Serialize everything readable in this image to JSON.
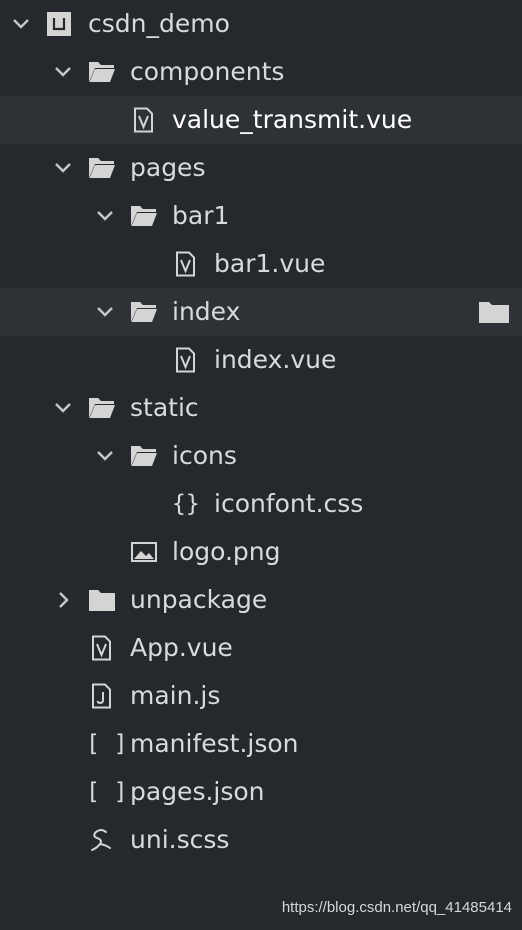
{
  "tree": {
    "root": "csdn_demo",
    "components_folder": "components",
    "value_transmit_file": "value_transmit.vue",
    "pages_folder": "pages",
    "bar1_folder": "bar1",
    "bar1_file": "bar1.vue",
    "index_folder": "index",
    "index_file": "index.vue",
    "static_folder": "static",
    "icons_folder": "icons",
    "iconfont_file": "iconfont.css",
    "logo_file": "logo.png",
    "unpackage_folder": "unpackage",
    "app_file": "App.vue",
    "main_file": "main.js",
    "manifest_file": "manifest.json",
    "pages_json_file": "pages.json",
    "uni_scss_file": "uni.scss"
  },
  "glyphs": {
    "css_braces": "{}",
    "json_brackets": "[ ]"
  },
  "watermark": "https://blog.csdn.net/qq_41485414",
  "colors": {
    "background": "#25282c",
    "row_highlight": "#2e3135",
    "text": "#d7dadf",
    "icon": "#d4d4d4"
  }
}
